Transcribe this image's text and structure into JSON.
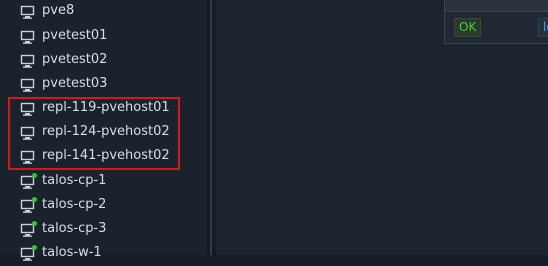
{
  "tree": {
    "items": [
      {
        "label": "pve8",
        "running": false
      },
      {
        "label": "pvetest01",
        "running": false
      },
      {
        "label": "pvetest02",
        "running": false
      },
      {
        "label": "pvetest03",
        "running": false
      },
      {
        "label": "repl-119-pvehost01",
        "running": false
      },
      {
        "label": "repl-124-pvehost02",
        "running": false
      },
      {
        "label": "repl-141-pvehost02",
        "running": false
      },
      {
        "label": "talos-cp-1",
        "running": true
      },
      {
        "label": "talos-cp-2",
        "running": true
      },
      {
        "label": "talos-cp-3",
        "running": true
      },
      {
        "label": "talos-w-1",
        "running": true
      }
    ]
  },
  "dialog": {
    "ok_label": "OK",
    "second_label": "lo"
  },
  "colors": {
    "highlight": "#d21818",
    "running_dot": "#2ec82e",
    "accent_green": "#4fc34f"
  },
  "icons": {
    "vm": "monitor-icon",
    "status": "status-running-icon"
  }
}
